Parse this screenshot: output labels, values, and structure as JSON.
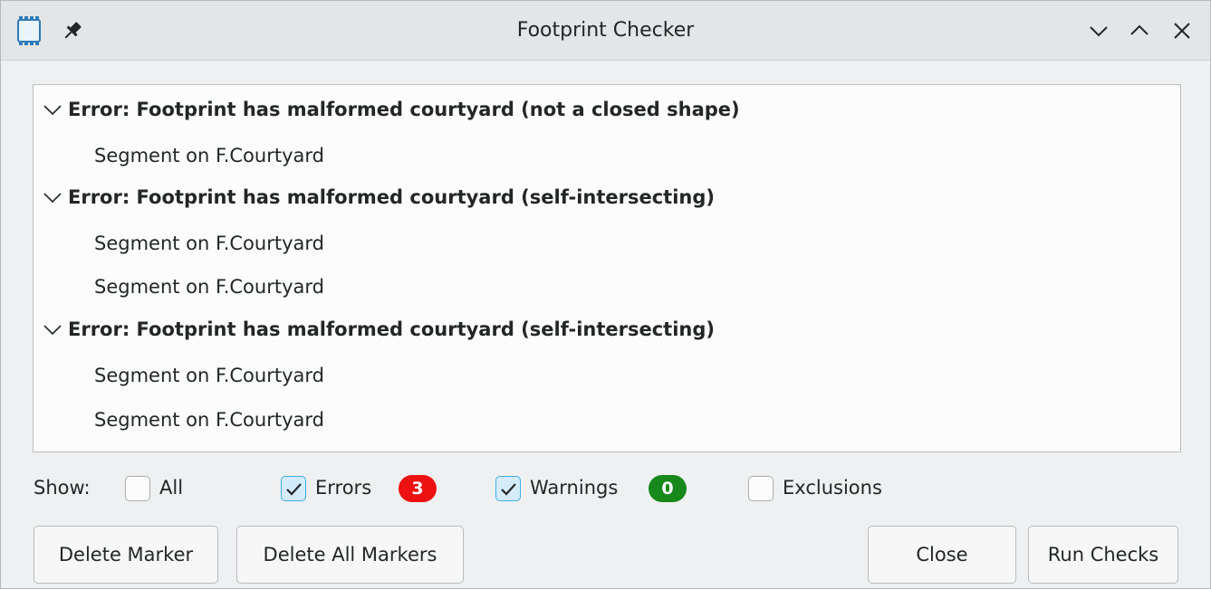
{
  "window": {
    "title": "Footprint Checker",
    "icons": {
      "app": "footprint-chip-icon",
      "pin": "pin-icon",
      "minimize": "chevron-down-icon",
      "maximize": "chevron-up-icon",
      "close": "close-icon"
    }
  },
  "markers": [
    {
      "label": "Error: Footprint has malformed courtyard (not a closed shape)",
      "items": [
        "Segment on F.Courtyard"
      ]
    },
    {
      "label": "Error: Footprint has malformed courtyard (self-intersecting)",
      "items": [
        "Segment on F.Courtyard",
        "Segment on F.Courtyard"
      ]
    },
    {
      "label": "Error: Footprint has malformed courtyard (self-intersecting)",
      "items": [
        "Segment on F.Courtyard",
        "Segment on F.Courtyard"
      ]
    }
  ],
  "filter": {
    "show_label": "Show:",
    "all": {
      "label": "All",
      "checked": false
    },
    "errors": {
      "label": "Errors",
      "checked": true,
      "count": "3"
    },
    "warnings": {
      "label": "Warnings",
      "checked": true,
      "count": "0"
    },
    "exclusions": {
      "label": "Exclusions",
      "checked": false
    }
  },
  "buttons": {
    "delete_marker": "Delete Marker",
    "delete_all_markers": "Delete All Markers",
    "close": "Close",
    "run_checks": "Run Checks"
  },
  "colors": {
    "error_badge": "#ee1111",
    "warning_badge": "#16891a",
    "accent": "#3daee9"
  }
}
